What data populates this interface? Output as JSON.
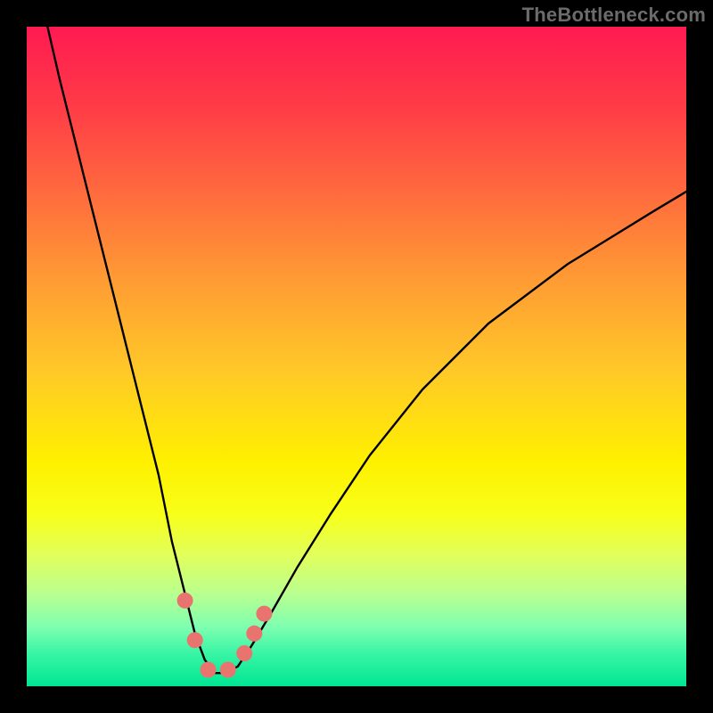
{
  "watermark": "TheBottleneck.com",
  "chart_data": {
    "type": "line",
    "title": "",
    "xlabel": "",
    "ylabel": "",
    "xlim": [
      0,
      100
    ],
    "ylim": [
      0,
      100
    ],
    "series": [
      {
        "name": "bottleneck-curve",
        "x": [
          2,
          5,
          8,
          11,
          14,
          17,
          20,
          22,
          24,
          25.5,
          27,
          28.5,
          30,
          32,
          34,
          37,
          41,
          46,
          52,
          60,
          70,
          82,
          95,
          100
        ],
        "values": [
          105,
          92,
          80,
          68,
          56,
          44,
          32,
          22,
          14,
          8,
          4,
          2,
          2,
          3,
          6,
          11,
          18,
          26,
          35,
          45,
          55,
          64,
          72,
          75
        ]
      }
    ],
    "markers": {
      "name": "highlight-dots",
      "x": [
        24,
        25.5,
        27.5,
        30.5,
        33,
        34.5,
        36
      ],
      "values": [
        13,
        7,
        2.5,
        2.5,
        5,
        8,
        11
      ],
      "color": "#e9746f",
      "radius_px": 9
    }
  }
}
